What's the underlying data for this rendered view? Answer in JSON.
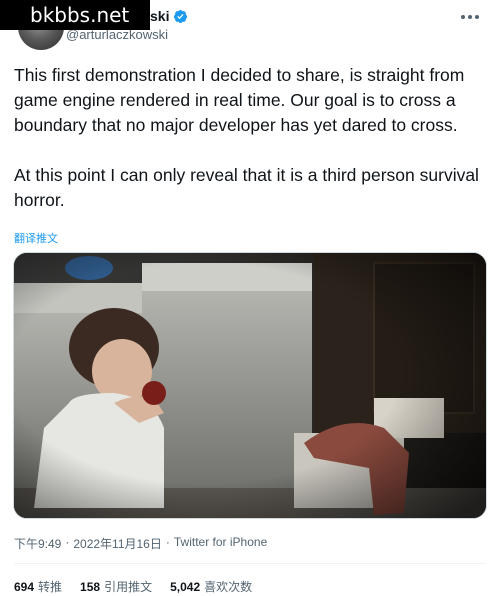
{
  "watermark": "bkbbs.net",
  "author": {
    "display_name_visible": "ski",
    "handle": "@arturlaczkowski"
  },
  "tweet": {
    "text": "This first demonstration I decided to share, is straight from game engine rendered in real time. Our goal is to cross a boundary that no major developer has yet dared to cross.\n\nAt this point I can only reveal that it is a third person survival horror.",
    "translate_label": "翻译推文"
  },
  "meta": {
    "time": "下午9:49",
    "date": "2022年11月16日",
    "separator": "·",
    "source": "Twitter for iPhone"
  },
  "stats": {
    "retweets_count": "694",
    "retweets_label": "转推",
    "quotes_count": "158",
    "quotes_label": "引用推文",
    "likes_count": "5,042",
    "likes_label": "喜欢次数"
  },
  "colors": {
    "link": "#1d9bf0",
    "secondary_text": "#536471",
    "verified": "#1d9bf0"
  }
}
